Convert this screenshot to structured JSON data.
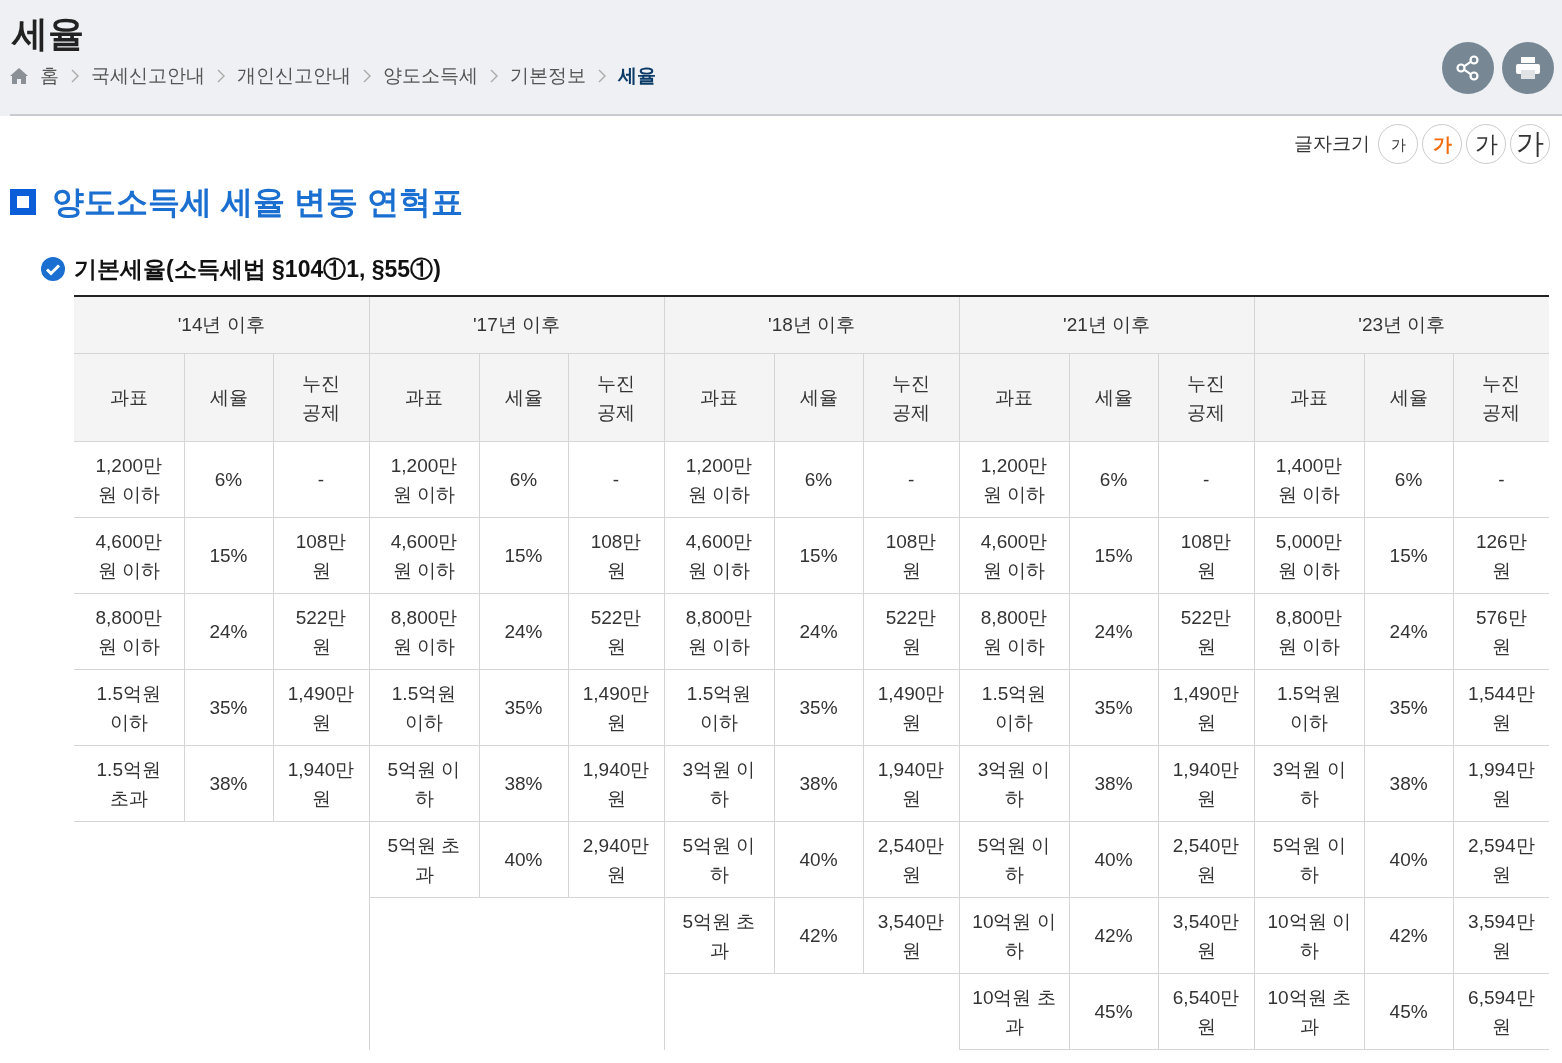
{
  "page_title": "세율",
  "breadcrumb": [
    {
      "label": "홈",
      "current": false
    },
    {
      "label": "국세신고안내",
      "current": false
    },
    {
      "label": "개인신고안내",
      "current": false
    },
    {
      "label": "양도소득세",
      "current": false
    },
    {
      "label": "기본정보",
      "current": false
    },
    {
      "label": "세율",
      "current": true
    }
  ],
  "font_size": {
    "label": "글자크기",
    "options": [
      {
        "label": "가",
        "selected": false
      },
      {
        "label": "가",
        "selected": true
      },
      {
        "label": "가",
        "selected": false
      },
      {
        "label": "가",
        "selected": false
      }
    ]
  },
  "section_title": "양도소득세 세율 변동 연혁표",
  "subsection_title": "기본세율(소득세법 §104①1, §55①)",
  "table": {
    "eras": [
      {
        "heading": "'14년 이후",
        "sub_columns": [
          "과표",
          "세율",
          "누진 공제"
        ],
        "rows": [
          [
            "1,200만 원 이하",
            "6%",
            "-"
          ],
          [
            "4,600만 원 이하",
            "15%",
            "108만 원"
          ],
          [
            "8,800만 원 이하",
            "24%",
            "522만 원"
          ],
          [
            "1.5억원 이하",
            "35%",
            "1,490만 원"
          ],
          [
            "1.5억원 초과",
            "38%",
            "1,940만 원"
          ]
        ]
      },
      {
        "heading": "'17년 이후",
        "sub_columns": [
          "과표",
          "세율",
          "누진 공제"
        ],
        "rows": [
          [
            "1,200만 원 이하",
            "6%",
            "-"
          ],
          [
            "4,600만 원 이하",
            "15%",
            "108만 원"
          ],
          [
            "8,800만 원 이하",
            "24%",
            "522만 원"
          ],
          [
            "1.5억원 이하",
            "35%",
            "1,490만 원"
          ],
          [
            "5억원 이하",
            "38%",
            "1,940만 원"
          ],
          [
            "5억원 초과",
            "40%",
            "2,940만 원"
          ]
        ]
      },
      {
        "heading": "'18년 이후",
        "sub_columns": [
          "과표",
          "세율",
          "누진 공제"
        ],
        "rows": [
          [
            "1,200만 원 이하",
            "6%",
            "-"
          ],
          [
            "4,600만 원 이하",
            "15%",
            "108만 원"
          ],
          [
            "8,800만 원 이하",
            "24%",
            "522만 원"
          ],
          [
            "1.5억원 이하",
            "35%",
            "1,490만 원"
          ],
          [
            "3억원 이하",
            "38%",
            "1,940만 원"
          ],
          [
            "5억원 이하",
            "40%",
            "2,540만 원"
          ],
          [
            "5억원 초과",
            "42%",
            "3,540만 원"
          ]
        ]
      },
      {
        "heading": "'21년 이후",
        "sub_columns": [
          "과표",
          "세율",
          "누진 공제"
        ],
        "rows": [
          [
            "1,200만 원 이하",
            "6%",
            "-"
          ],
          [
            "4,600만 원 이하",
            "15%",
            "108만 원"
          ],
          [
            "8,800만 원 이하",
            "24%",
            "522만 원"
          ],
          [
            "1.5억원 이하",
            "35%",
            "1,490만 원"
          ],
          [
            "3억원 이하",
            "38%",
            "1,940만 원"
          ],
          [
            "5억원 이하",
            "40%",
            "2,540만 원"
          ],
          [
            "10억원 이하",
            "42%",
            "3,540만 원"
          ],
          [
            "10억원 초과",
            "45%",
            "6,540만 원"
          ]
        ]
      },
      {
        "heading": "'23년 이후",
        "sub_columns": [
          "과표",
          "세율",
          "누진 공제"
        ],
        "rows": [
          [
            "1,400만 원 이하",
            "6%",
            "-"
          ],
          [
            "5,000만 원 이하",
            "15%",
            "126만 원"
          ],
          [
            "8,800만 원 이하",
            "24%",
            "576만 원"
          ],
          [
            "1.5억원 이하",
            "35%",
            "1,544만 원"
          ],
          [
            "3억원 이하",
            "38%",
            "1,994만 원"
          ],
          [
            "5억원 이하",
            "40%",
            "2,594만 원"
          ],
          [
            "10억원 이하",
            "42%",
            "3,594만 원"
          ],
          [
            "10억원 초과",
            "45%",
            "6,594만 원"
          ]
        ]
      }
    ]
  }
}
